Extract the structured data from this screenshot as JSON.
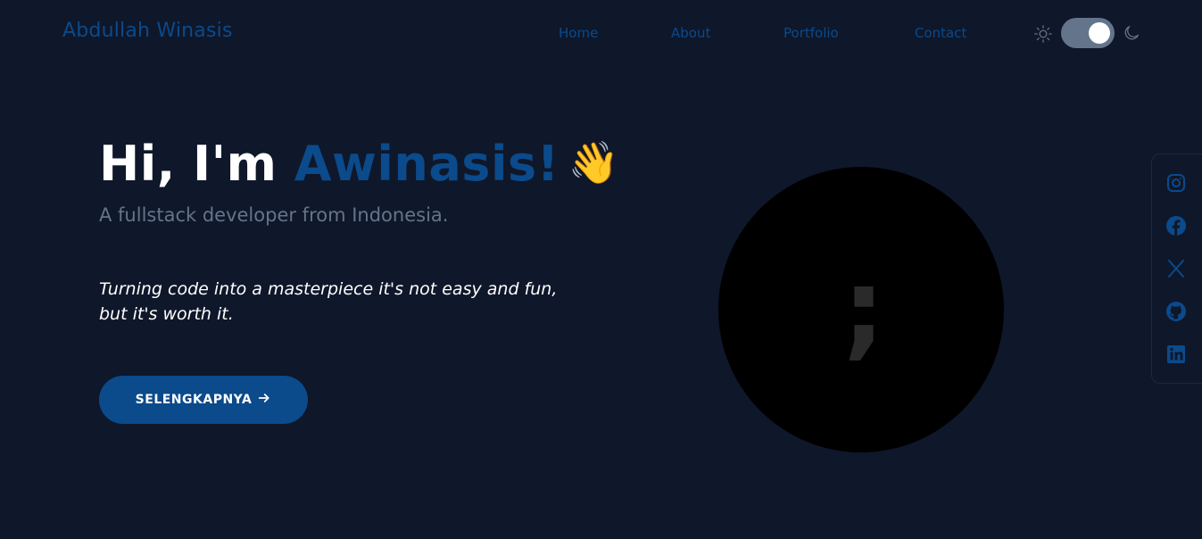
{
  "navbar": {
    "brand": "Abdullah Winasis",
    "links": [
      "Home",
      "About",
      "Portfolio",
      "Contact"
    ]
  },
  "theme_toggle": {
    "state": "dark",
    "icons": [
      "sun-icon",
      "moon-icon"
    ]
  },
  "hero": {
    "greeting": "Hi, I'm",
    "name": "Awinasis!",
    "emoji": "👋",
    "subtitle": "A fullstack developer from Indonesia.",
    "quote": "Turning code into a masterpiece it's not easy and fun, but it's worth it.",
    "cta_label": "SELENGKAPNYA",
    "cta_icon": "arrow-right-icon",
    "avatar_glyph": ";"
  },
  "social": [
    "instagram-icon",
    "facebook-icon",
    "x-icon",
    "github-icon",
    "linkedin-icon"
  ],
  "colors": {
    "background": "#0f172a",
    "accent": "#0b4a8b",
    "muted": "#64748b",
    "text": "#ffffff"
  }
}
